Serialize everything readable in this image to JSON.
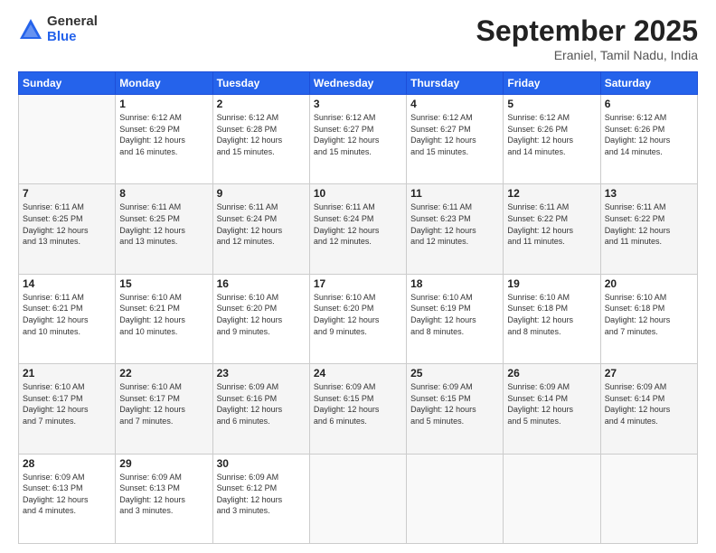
{
  "header": {
    "logo_general": "General",
    "logo_blue": "Blue",
    "month_title": "September 2025",
    "subtitle": "Eraniel, Tamil Nadu, India"
  },
  "weekdays": [
    "Sunday",
    "Monday",
    "Tuesday",
    "Wednesday",
    "Thursday",
    "Friday",
    "Saturday"
  ],
  "weeks": [
    [
      {
        "day": "",
        "info": ""
      },
      {
        "day": "1",
        "info": "Sunrise: 6:12 AM\nSunset: 6:29 PM\nDaylight: 12 hours\nand 16 minutes."
      },
      {
        "day": "2",
        "info": "Sunrise: 6:12 AM\nSunset: 6:28 PM\nDaylight: 12 hours\nand 15 minutes."
      },
      {
        "day": "3",
        "info": "Sunrise: 6:12 AM\nSunset: 6:27 PM\nDaylight: 12 hours\nand 15 minutes."
      },
      {
        "day": "4",
        "info": "Sunrise: 6:12 AM\nSunset: 6:27 PM\nDaylight: 12 hours\nand 15 minutes."
      },
      {
        "day": "5",
        "info": "Sunrise: 6:12 AM\nSunset: 6:26 PM\nDaylight: 12 hours\nand 14 minutes."
      },
      {
        "day": "6",
        "info": "Sunrise: 6:12 AM\nSunset: 6:26 PM\nDaylight: 12 hours\nand 14 minutes."
      }
    ],
    [
      {
        "day": "7",
        "info": "Sunrise: 6:11 AM\nSunset: 6:25 PM\nDaylight: 12 hours\nand 13 minutes."
      },
      {
        "day": "8",
        "info": "Sunrise: 6:11 AM\nSunset: 6:25 PM\nDaylight: 12 hours\nand 13 minutes."
      },
      {
        "day": "9",
        "info": "Sunrise: 6:11 AM\nSunset: 6:24 PM\nDaylight: 12 hours\nand 12 minutes."
      },
      {
        "day": "10",
        "info": "Sunrise: 6:11 AM\nSunset: 6:24 PM\nDaylight: 12 hours\nand 12 minutes."
      },
      {
        "day": "11",
        "info": "Sunrise: 6:11 AM\nSunset: 6:23 PM\nDaylight: 12 hours\nand 12 minutes."
      },
      {
        "day": "12",
        "info": "Sunrise: 6:11 AM\nSunset: 6:22 PM\nDaylight: 12 hours\nand 11 minutes."
      },
      {
        "day": "13",
        "info": "Sunrise: 6:11 AM\nSunset: 6:22 PM\nDaylight: 12 hours\nand 11 minutes."
      }
    ],
    [
      {
        "day": "14",
        "info": "Sunrise: 6:11 AM\nSunset: 6:21 PM\nDaylight: 12 hours\nand 10 minutes."
      },
      {
        "day": "15",
        "info": "Sunrise: 6:10 AM\nSunset: 6:21 PM\nDaylight: 12 hours\nand 10 minutes."
      },
      {
        "day": "16",
        "info": "Sunrise: 6:10 AM\nSunset: 6:20 PM\nDaylight: 12 hours\nand 9 minutes."
      },
      {
        "day": "17",
        "info": "Sunrise: 6:10 AM\nSunset: 6:20 PM\nDaylight: 12 hours\nand 9 minutes."
      },
      {
        "day": "18",
        "info": "Sunrise: 6:10 AM\nSunset: 6:19 PM\nDaylight: 12 hours\nand 8 minutes."
      },
      {
        "day": "19",
        "info": "Sunrise: 6:10 AM\nSunset: 6:18 PM\nDaylight: 12 hours\nand 8 minutes."
      },
      {
        "day": "20",
        "info": "Sunrise: 6:10 AM\nSunset: 6:18 PM\nDaylight: 12 hours\nand 7 minutes."
      }
    ],
    [
      {
        "day": "21",
        "info": "Sunrise: 6:10 AM\nSunset: 6:17 PM\nDaylight: 12 hours\nand 7 minutes."
      },
      {
        "day": "22",
        "info": "Sunrise: 6:10 AM\nSunset: 6:17 PM\nDaylight: 12 hours\nand 7 minutes."
      },
      {
        "day": "23",
        "info": "Sunrise: 6:09 AM\nSunset: 6:16 PM\nDaylight: 12 hours\nand 6 minutes."
      },
      {
        "day": "24",
        "info": "Sunrise: 6:09 AM\nSunset: 6:15 PM\nDaylight: 12 hours\nand 6 minutes."
      },
      {
        "day": "25",
        "info": "Sunrise: 6:09 AM\nSunset: 6:15 PM\nDaylight: 12 hours\nand 5 minutes."
      },
      {
        "day": "26",
        "info": "Sunrise: 6:09 AM\nSunset: 6:14 PM\nDaylight: 12 hours\nand 5 minutes."
      },
      {
        "day": "27",
        "info": "Sunrise: 6:09 AM\nSunset: 6:14 PM\nDaylight: 12 hours\nand 4 minutes."
      }
    ],
    [
      {
        "day": "28",
        "info": "Sunrise: 6:09 AM\nSunset: 6:13 PM\nDaylight: 12 hours\nand 4 minutes."
      },
      {
        "day": "29",
        "info": "Sunrise: 6:09 AM\nSunset: 6:13 PM\nDaylight: 12 hours\nand 3 minutes."
      },
      {
        "day": "30",
        "info": "Sunrise: 6:09 AM\nSunset: 6:12 PM\nDaylight: 12 hours\nand 3 minutes."
      },
      {
        "day": "",
        "info": ""
      },
      {
        "day": "",
        "info": ""
      },
      {
        "day": "",
        "info": ""
      },
      {
        "day": "",
        "info": ""
      }
    ]
  ]
}
